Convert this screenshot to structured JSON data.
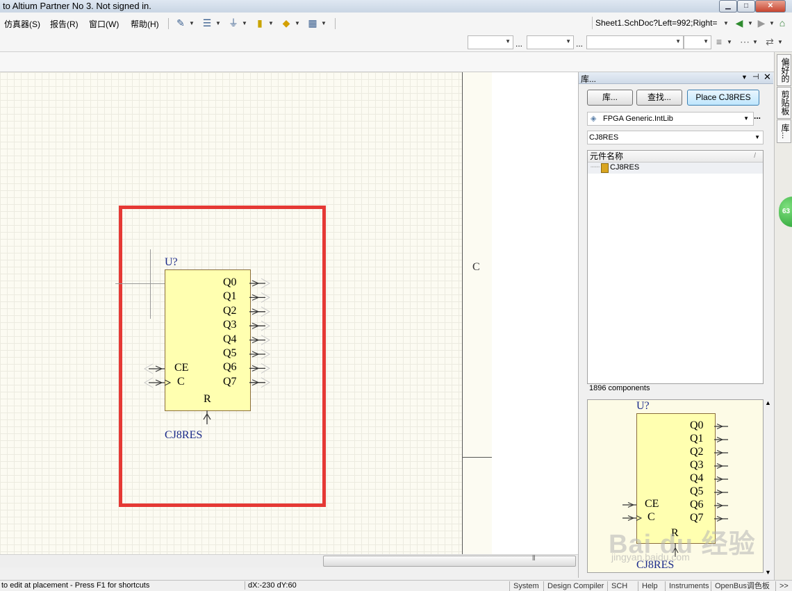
{
  "window": {
    "title": "to Altium Partner No 3. Not signed in.",
    "minimize": "▁",
    "maximize": "□",
    "close": "✕"
  },
  "menu": [
    {
      "label": "仿真器(S)"
    },
    {
      "label": "报告(R)"
    },
    {
      "label": "窗口(W)"
    },
    {
      "label": "帮助(H)"
    }
  ],
  "toolbar": {
    "doc_path": "Sheet1.SchDoc?Left=992;Right=",
    "icons": [
      "wire-tool-icon",
      "bus-tool-icon",
      "ground-icon",
      "part-icon",
      "net-label-icon",
      "grid-icon"
    ]
  },
  "toolbar2": {
    "ellipsis": "..."
  },
  "canvas": {
    "border_zone_label": "C",
    "component": {
      "designator": "U?",
      "comment": "CJ8RES",
      "left_pins": [
        "CE",
        "C"
      ],
      "right_pins": [
        "Q0",
        "Q1",
        "Q2",
        "Q3",
        "Q4",
        "Q5",
        "Q6",
        "Q7"
      ],
      "bottom_pin": "R",
      "body_color": "#ffffb0",
      "text_color": "#1a2a8a"
    },
    "highlight_color": "#e53935"
  },
  "library_panel": {
    "title": "库...",
    "buttons": {
      "libraries": "库...",
      "search": "查找...",
      "place": "Place CJ8RES"
    },
    "library_name": "FPGA Generic.IntLib",
    "library_more": "...",
    "filter_value": "CJ8RES",
    "list_header": "元件名称",
    "list_items": [
      {
        "name": "CJ8RES"
      }
    ],
    "count_text": "1896 components",
    "preview": {
      "designator": "U?",
      "comment": "CJ8RES"
    }
  },
  "dock_tabs": [
    "偏好的",
    "剪贴板",
    "库..."
  ],
  "badge": "63",
  "watermark": {
    "logo": "Bai du 经验",
    "url": "jingyan.baidu.com"
  },
  "status": {
    "hint": "to edit at placement - Press F1 for shortcuts",
    "coords": "dX:-230 dY:60",
    "tabs": [
      "System",
      "Design Compiler",
      "SCH",
      "Help",
      "Instruments",
      "OpenBus调色板"
    ],
    "more": ">>"
  }
}
